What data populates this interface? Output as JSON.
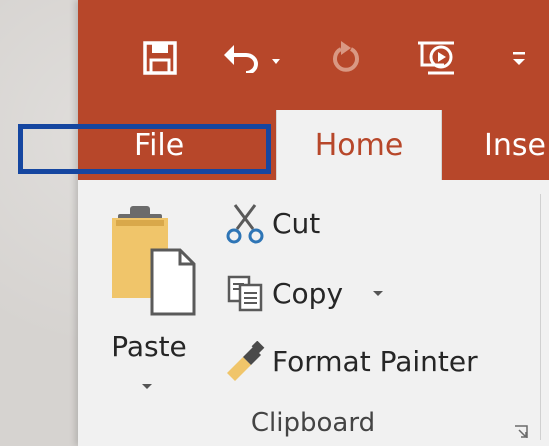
{
  "quick_access": {
    "save_icon": "save-icon",
    "undo_icon": "undo-icon",
    "redo_icon": "redo-icon",
    "slideshow_icon": "slideshow-icon",
    "customize_icon": "customize-icon"
  },
  "tabs": [
    {
      "label": "File"
    },
    {
      "label": "Home"
    },
    {
      "label": "Inse"
    }
  ],
  "clipboard": {
    "paste_label": "Paste",
    "cut_label": "Cut",
    "copy_label": "Copy",
    "format_painter_label": "Format Painter",
    "group_label": "Clipboard"
  },
  "colors": {
    "title_bar": "#b7472a",
    "ribbon": "#f1f1f1",
    "highlight": "#1546a0",
    "active_tab_text": "#b7472a"
  }
}
